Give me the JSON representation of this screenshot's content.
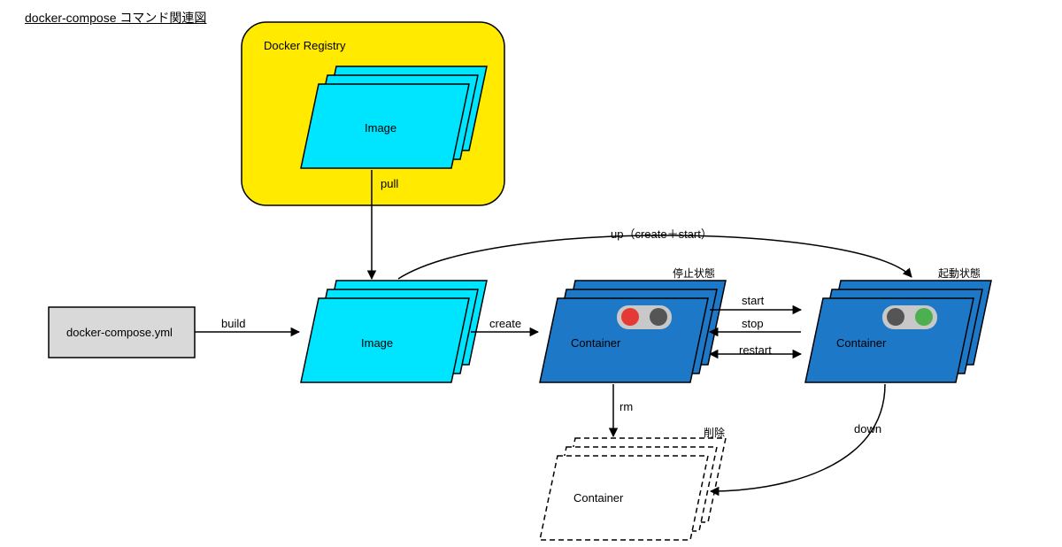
{
  "title": "docker-compose コマンド関連図",
  "nodes": {
    "yml_file": "docker-compose.yml",
    "registry_title": "Docker Registry",
    "registry_image": "Image",
    "local_image": "Image",
    "container_stopped_title": "停止状態",
    "container_stopped_label": "Container",
    "container_running_title": "起動状態",
    "container_running_label": "Container",
    "container_deleted_title": "削除",
    "container_deleted_label": "Container"
  },
  "arrows": {
    "build": "build",
    "pull": "pull",
    "create": "create",
    "start": "start",
    "stop": "stop",
    "restart": "restart",
    "rm": "rm",
    "down": "down",
    "up": "up（create＋start）"
  }
}
